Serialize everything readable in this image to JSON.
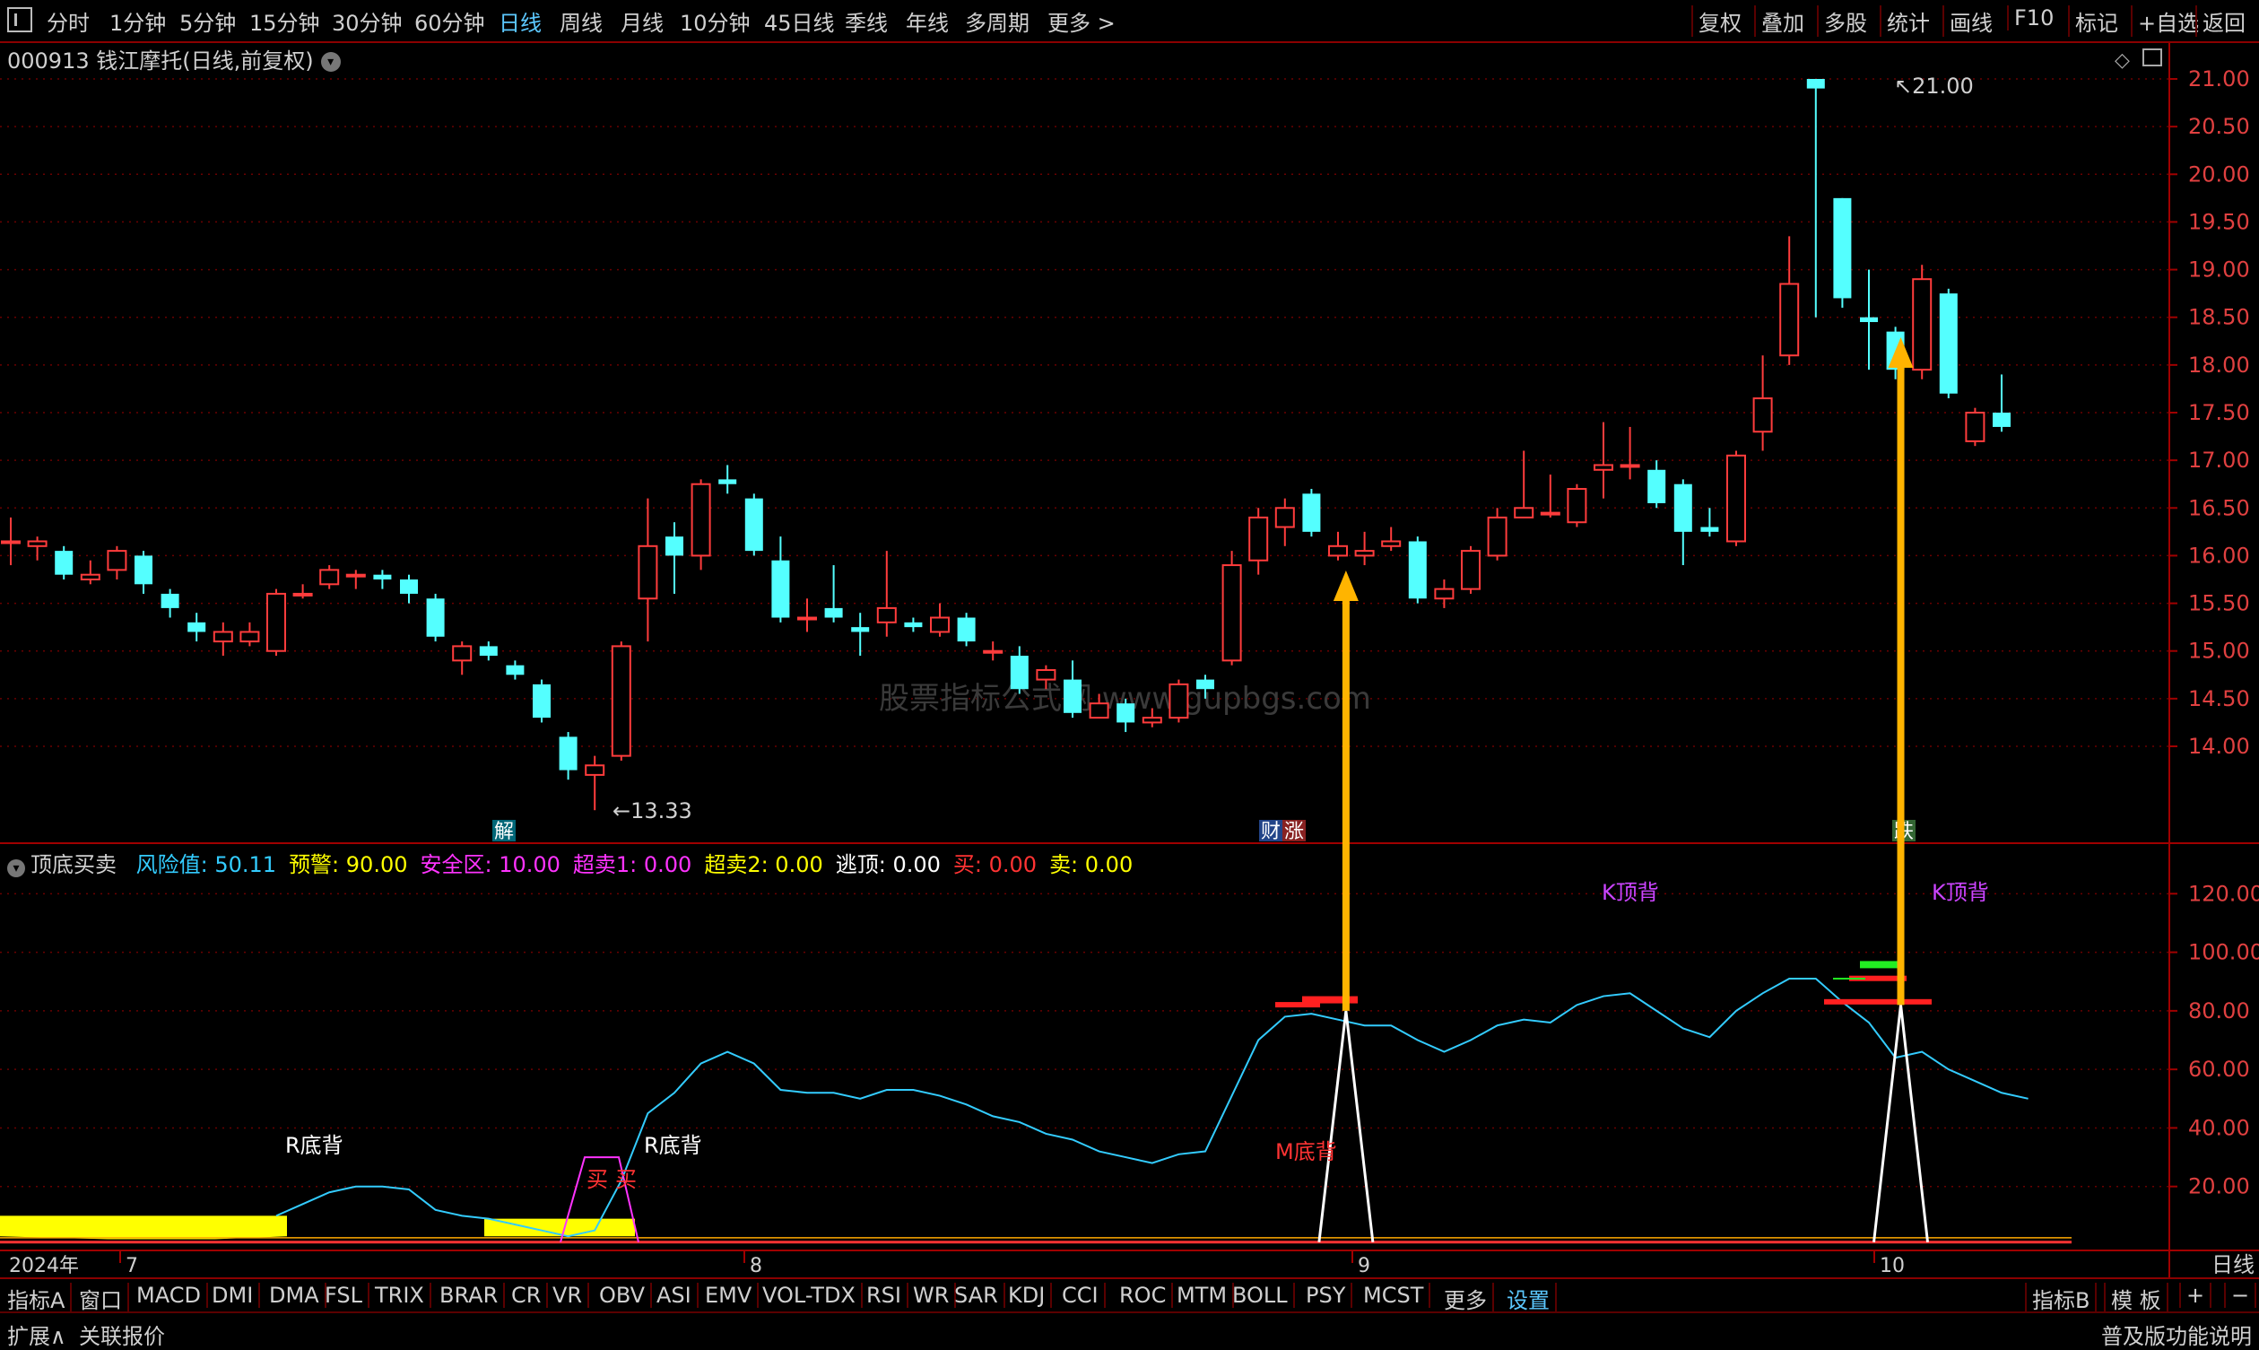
{
  "toolbar": {
    "timeframes": [
      "分时",
      "1分钟",
      "5分钟",
      "15分钟",
      "30分钟",
      "60分钟",
      "日线",
      "周线",
      "月线",
      "10分钟",
      "45日线",
      "季线",
      "年线",
      "多周期",
      "更多 >"
    ],
    "active": "日线",
    "right_buttons": [
      "复权",
      "叠加",
      "多股",
      "统计",
      "画线",
      "F10",
      "标记",
      "+自选",
      "返回"
    ]
  },
  "title": "000913 钱江摩托(日线,前复权)",
  "price_axis": [
    "21.00",
    "20.50",
    "20.00",
    "19.50",
    "19.00",
    "18.50",
    "18.00",
    "17.50",
    "17.00",
    "16.50",
    "16.00",
    "15.50",
    "15.00",
    "14.50",
    "14.00"
  ],
  "indicator_axis": [
    "120.00",
    "100.00",
    "80.00",
    "60.00",
    "40.00",
    "20.00"
  ],
  "annotations": {
    "high_label": "21.00",
    "low_label": "13.33",
    "watermark": "股票指标公式网 www.gupbgs.com",
    "event_jie": "解",
    "event_cai": "财",
    "event_zhang": "涨",
    "event_die": "跌",
    "r_bottom_1": "R底背",
    "r_bottom_2": "R底背",
    "m_bottom": "M底背",
    "k_top_1": "K顶背",
    "k_top_2": "K顶背",
    "buy_1": "买",
    "buy_2": "买"
  },
  "indicator": {
    "name": "顶底买卖",
    "items": [
      {
        "label": "风险值: 50.11",
        "color": "#33ccff"
      },
      {
        "label": "预警: 90.00",
        "color": "#ffff00"
      },
      {
        "label": "安全区: 10.00",
        "color": "#ff33ff"
      },
      {
        "label": "超卖1: 0.00",
        "color": "#ff33ff"
      },
      {
        "label": "超卖2: 0.00",
        "color": "#ffff00"
      },
      {
        "label": "逃顶: 0.00",
        "color": "#ffffff"
      },
      {
        "label": "买: 0.00",
        "color": "#ff3333"
      },
      {
        "label": "卖: 0.00",
        "color": "#ffff00"
      }
    ]
  },
  "date_axis": {
    "year": "2024年",
    "months": [
      "7",
      "8",
      "9",
      "10"
    ],
    "period": "日线"
  },
  "bottom_tabs": [
    "指标A",
    "窗口",
    "MACD",
    "DMI",
    "DMA",
    "FSL",
    "TRIX",
    "BRAR",
    "CR",
    "VR",
    "OBV",
    "ASI",
    "EMV",
    "VOL-TDX",
    "RSI",
    "WR",
    "SAR",
    "KDJ",
    "CCI",
    "ROC",
    "MTM",
    "BOLL",
    "PSY",
    "MCST",
    "更多",
    "设置"
  ],
  "bottom_right": [
    "指标B",
    "模 板",
    "+",
    "−"
  ],
  "status": {
    "left": [
      "扩展∧",
      "关联报价"
    ],
    "right": "普及版功能说明"
  },
  "chart_data": {
    "type": "candlestick",
    "price_ylim": [
      13.5,
      21.2
    ],
    "candles": [
      {
        "o": 16.15,
        "c": 16.15,
        "h": 16.4,
        "l": 15.9
      },
      {
        "o": 16.1,
        "c": 16.15,
        "h": 16.2,
        "l": 15.95
      },
      {
        "o": 16.05,
        "c": 15.8,
        "h": 16.1,
        "l": 15.75
      },
      {
        "o": 15.75,
        "c": 15.8,
        "h": 15.95,
        "l": 15.7
      },
      {
        "o": 15.85,
        "c": 16.05,
        "h": 16.1,
        "l": 15.75
      },
      {
        "o": 16.0,
        "c": 15.7,
        "h": 16.05,
        "l": 15.6
      },
      {
        "o": 15.6,
        "c": 15.45,
        "h": 15.65,
        "l": 15.35
      },
      {
        "o": 15.3,
        "c": 15.2,
        "h": 15.4,
        "l": 15.1
      },
      {
        "o": 15.1,
        "c": 15.2,
        "h": 15.3,
        "l": 14.95
      },
      {
        "o": 15.1,
        "c": 15.2,
        "h": 15.3,
        "l": 15.05
      },
      {
        "o": 15.0,
        "c": 15.6,
        "h": 15.65,
        "l": 14.95
      },
      {
        "o": 15.6,
        "c": 15.6,
        "h": 15.7,
        "l": 15.55
      },
      {
        "o": 15.7,
        "c": 15.85,
        "h": 15.9,
        "l": 15.65
      },
      {
        "o": 15.8,
        "c": 15.8,
        "h": 15.85,
        "l": 15.65
      },
      {
        "o": 15.8,
        "c": 15.75,
        "h": 15.85,
        "l": 15.65
      },
      {
        "o": 15.75,
        "c": 15.6,
        "h": 15.8,
        "l": 15.5
      },
      {
        "o": 15.55,
        "c": 15.15,
        "h": 15.6,
        "l": 15.1
      },
      {
        "o": 14.9,
        "c": 15.05,
        "h": 15.1,
        "l": 14.75
      },
      {
        "o": 15.05,
        "c": 14.95,
        "h": 15.1,
        "l": 14.9
      },
      {
        "o": 14.85,
        "c": 14.75,
        "h": 14.9,
        "l": 14.7
      },
      {
        "o": 14.65,
        "c": 14.3,
        "h": 14.7,
        "l": 14.25
      },
      {
        "o": 14.1,
        "c": 13.75,
        "h": 14.15,
        "l": 13.65
      },
      {
        "o": 13.7,
        "c": 13.8,
        "h": 13.9,
        "l": 13.33
      },
      {
        "o": 13.9,
        "c": 15.05,
        "h": 15.1,
        "l": 13.85
      },
      {
        "o": 15.55,
        "c": 16.1,
        "h": 16.6,
        "l": 15.1
      },
      {
        "o": 16.2,
        "c": 16.0,
        "h": 16.35,
        "l": 15.6
      },
      {
        "o": 16.0,
        "c": 16.75,
        "h": 16.8,
        "l": 15.85
      },
      {
        "o": 16.8,
        "c": 16.75,
        "h": 16.95,
        "l": 16.65
      },
      {
        "o": 16.6,
        "c": 16.05,
        "h": 16.65,
        "l": 16.0
      },
      {
        "o": 15.95,
        "c": 15.35,
        "h": 16.2,
        "l": 15.3
      },
      {
        "o": 15.35,
        "c": 15.35,
        "h": 15.55,
        "l": 15.2
      },
      {
        "o": 15.45,
        "c": 15.35,
        "h": 15.9,
        "l": 15.3
      },
      {
        "o": 15.25,
        "c": 15.2,
        "h": 15.4,
        "l": 14.95
      },
      {
        "o": 15.3,
        "c": 15.45,
        "h": 16.05,
        "l": 15.15
      },
      {
        "o": 15.3,
        "c": 15.25,
        "h": 15.35,
        "l": 15.2
      },
      {
        "o": 15.2,
        "c": 15.35,
        "h": 15.5,
        "l": 15.15
      },
      {
        "o": 15.35,
        "c": 15.1,
        "h": 15.4,
        "l": 15.05
      },
      {
        "o": 15.0,
        "c": 15.0,
        "h": 15.1,
        "l": 14.9
      },
      {
        "o": 14.95,
        "c": 14.6,
        "h": 15.05,
        "l": 14.55
      },
      {
        "o": 14.7,
        "c": 14.8,
        "h": 14.85,
        "l": 14.6
      },
      {
        "o": 14.7,
        "c": 14.35,
        "h": 14.9,
        "l": 14.3
      },
      {
        "o": 14.3,
        "c": 14.45,
        "h": 14.55,
        "l": 14.3
      },
      {
        "o": 14.45,
        "c": 14.25,
        "h": 14.5,
        "l": 14.15
      },
      {
        "o": 14.25,
        "c": 14.3,
        "h": 14.4,
        "l": 14.2
      },
      {
        "o": 14.3,
        "c": 14.65,
        "h": 14.7,
        "l": 14.25
      },
      {
        "o": 14.7,
        "c": 14.6,
        "h": 14.75,
        "l": 14.5
      },
      {
        "o": 14.9,
        "c": 15.9,
        "h": 16.05,
        "l": 14.85
      },
      {
        "o": 15.95,
        "c": 16.4,
        "h": 16.5,
        "l": 15.8
      },
      {
        "o": 16.3,
        "c": 16.5,
        "h": 16.6,
        "l": 16.1
      },
      {
        "o": 16.65,
        "c": 16.25,
        "h": 16.7,
        "l": 16.2
      },
      {
        "o": 16.0,
        "c": 16.1,
        "h": 16.25,
        "l": 15.95
      },
      {
        "o": 16.0,
        "c": 16.05,
        "h": 16.25,
        "l": 15.9
      },
      {
        "o": 16.1,
        "c": 16.15,
        "h": 16.3,
        "l": 16.05
      },
      {
        "o": 16.15,
        "c": 15.55,
        "h": 16.2,
        "l": 15.5
      },
      {
        "o": 15.55,
        "c": 15.65,
        "h": 15.75,
        "l": 15.45
      },
      {
        "o": 15.65,
        "c": 16.05,
        "h": 16.1,
        "l": 15.6
      },
      {
        "o": 16.0,
        "c": 16.4,
        "h": 16.5,
        "l": 15.95
      },
      {
        "o": 16.4,
        "c": 16.5,
        "h": 17.1,
        "l": 16.4
      },
      {
        "o": 16.45,
        "c": 16.45,
        "h": 16.85,
        "l": 16.4
      },
      {
        "o": 16.35,
        "c": 16.7,
        "h": 16.75,
        "l": 16.3
      },
      {
        "o": 16.9,
        "c": 16.95,
        "h": 17.4,
        "l": 16.6
      },
      {
        "o": 16.95,
        "c": 16.95,
        "h": 17.35,
        "l": 16.8
      },
      {
        "o": 16.9,
        "c": 16.55,
        "h": 17.0,
        "l": 16.5
      },
      {
        "o": 16.75,
        "c": 16.25,
        "h": 16.8,
        "l": 15.9
      },
      {
        "o": 16.3,
        "c": 16.25,
        "h": 16.5,
        "l": 16.2
      },
      {
        "o": 16.15,
        "c": 17.05,
        "h": 17.1,
        "l": 16.1
      },
      {
        "o": 17.3,
        "c": 17.65,
        "h": 18.1,
        "l": 17.1
      },
      {
        "o": 18.1,
        "c": 18.85,
        "h": 19.35,
        "l": 18.0
      },
      {
        "o": 21.0,
        "c": 20.9,
        "h": 21.0,
        "l": 18.5
      },
      {
        "o": 19.75,
        "c": 18.7,
        "h": 19.75,
        "l": 18.6
      },
      {
        "o": 18.5,
        "c": 18.45,
        "h": 19.0,
        "l": 17.95
      },
      {
        "o": 18.35,
        "c": 17.95,
        "h": 18.4,
        "l": 17.85
      },
      {
        "o": 17.95,
        "c": 18.9,
        "h": 19.05,
        "l": 17.85
      },
      {
        "o": 18.75,
        "c": 17.7,
        "h": 18.8,
        "l": 17.65
      },
      {
        "o": 17.2,
        "c": 17.5,
        "h": 17.55,
        "l": 17.15
      },
      {
        "o": 17.5,
        "c": 17.35,
        "h": 17.9,
        "l": 17.3
      }
    ],
    "risk_value_line": [
      null,
      null,
      null,
      null,
      null,
      null,
      null,
      null,
      null,
      null,
      10.0,
      14.0,
      18.0,
      20.0,
      20.0,
      19.0,
      12.0,
      10.0,
      9.0,
      7.0,
      5.0,
      3.0,
      5.0,
      22.0,
      45.0,
      52.0,
      62.0,
      66.0,
      62.0,
      53.0,
      52.0,
      52.0,
      50.0,
      53.0,
      53.0,
      51.0,
      48.0,
      44.0,
      42.0,
      38.0,
      36.0,
      32.0,
      30.0,
      28.0,
      31.0,
      32.0,
      51.0,
      70.0,
      78.0,
      79.0,
      77.0,
      75.0,
      75.0,
      70.0,
      66.0,
      70.0,
      75.0,
      77.0,
      76.0,
      82.0,
      85.0,
      86.0,
      80.0,
      74.0,
      71.0,
      80.0,
      86.0,
      91.0,
      91.0,
      83.0,
      76.0,
      64.0,
      66.0,
      60.0,
      56.0,
      52.0,
      50.0
    ],
    "ind_ylim": [
      0,
      125
    ]
  }
}
